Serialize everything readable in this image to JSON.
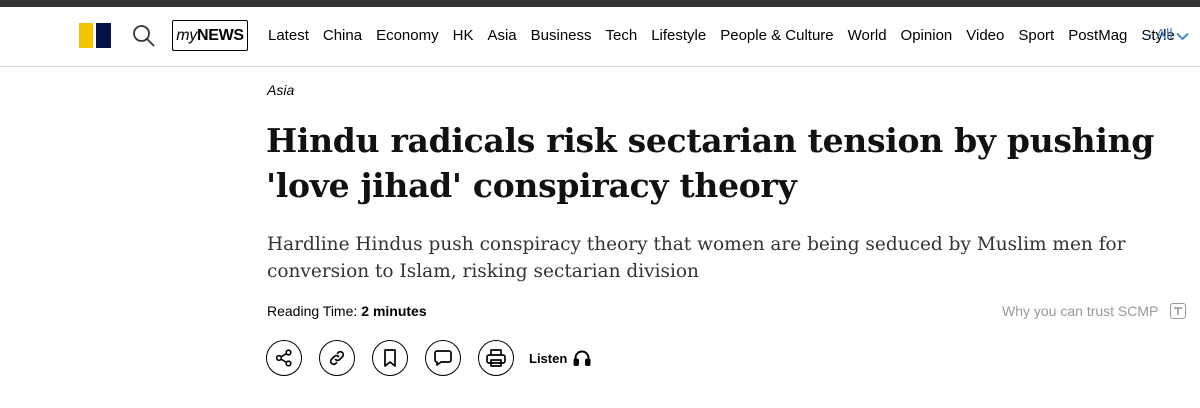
{
  "nav": {
    "brand_prefix": "my",
    "brand_suffix": "NEWS",
    "links": [
      "Latest",
      "China",
      "Economy",
      "HK",
      "Asia",
      "Business",
      "Tech",
      "Lifestyle",
      "People & Culture",
      "World",
      "Opinion",
      "Video",
      "Sport",
      "PostMag",
      "Style"
    ],
    "dash": "-",
    "all_label": "All"
  },
  "article": {
    "category": "Asia",
    "headline": "Hindu radicals risk sectarian tension by pushing 'love jihad' conspiracy theory",
    "subheadline": "Hardline Hindus push conspiracy theory that women are being seduced by Muslim men for conversion to Islam, risking sectarian division",
    "reading_time_label": "Reading Time:",
    "reading_time_value": "2 minutes",
    "trust_label": "Why you can trust SCMP"
  },
  "actions": {
    "listen_label": "Listen"
  },
  "colors": {
    "logo_yellow": "#f5c400",
    "logo_navy": "#001246",
    "nav_all": "#4a8ad8",
    "muted": "#999999"
  },
  "icons": [
    "search-icon",
    "share-icon",
    "link-icon",
    "bookmark-icon",
    "comment-icon",
    "print-icon",
    "headphones-icon",
    "trust-t-icon",
    "chevron-down-icon"
  ]
}
